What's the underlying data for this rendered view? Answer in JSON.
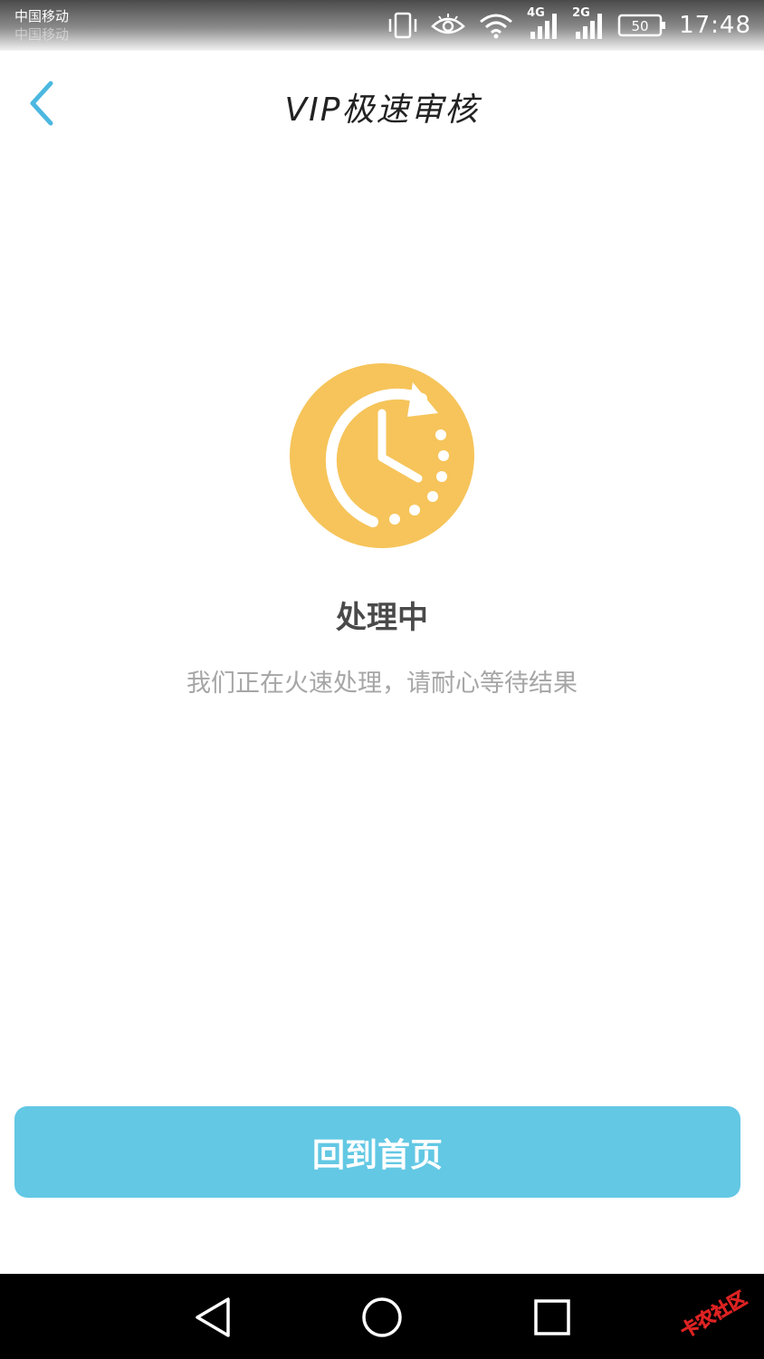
{
  "status_bar": {
    "carrier_1": "中国移动",
    "carrier_2": "中国移动",
    "network_1": "4G",
    "network_2": "2G",
    "battery": "50",
    "time": "17:48",
    "icons": [
      "vibrate-icon",
      "eye-icon",
      "wifi-icon",
      "signal-4g-icon",
      "signal-2g-icon",
      "battery-icon"
    ]
  },
  "header": {
    "title": "VIP极速审核",
    "back_icon": "chevron-left-icon"
  },
  "status": {
    "icon": "clock-refresh-icon",
    "title": "处理中",
    "description": "我们正在火速处理，请耐心等待结果"
  },
  "actions": {
    "home_label": "回到首页"
  },
  "nav_bar": {
    "icons": [
      "nav-back-icon",
      "nav-home-icon",
      "nav-recent-icon"
    ]
  },
  "watermark": {
    "text": "卡农社区"
  },
  "colors": {
    "accent": "#63c8e4",
    "back_chevron": "#4cb8e0",
    "status_icon": "#f6c45a",
    "title_text": "#4a4a4a",
    "desc_text": "#a6a6a6"
  }
}
